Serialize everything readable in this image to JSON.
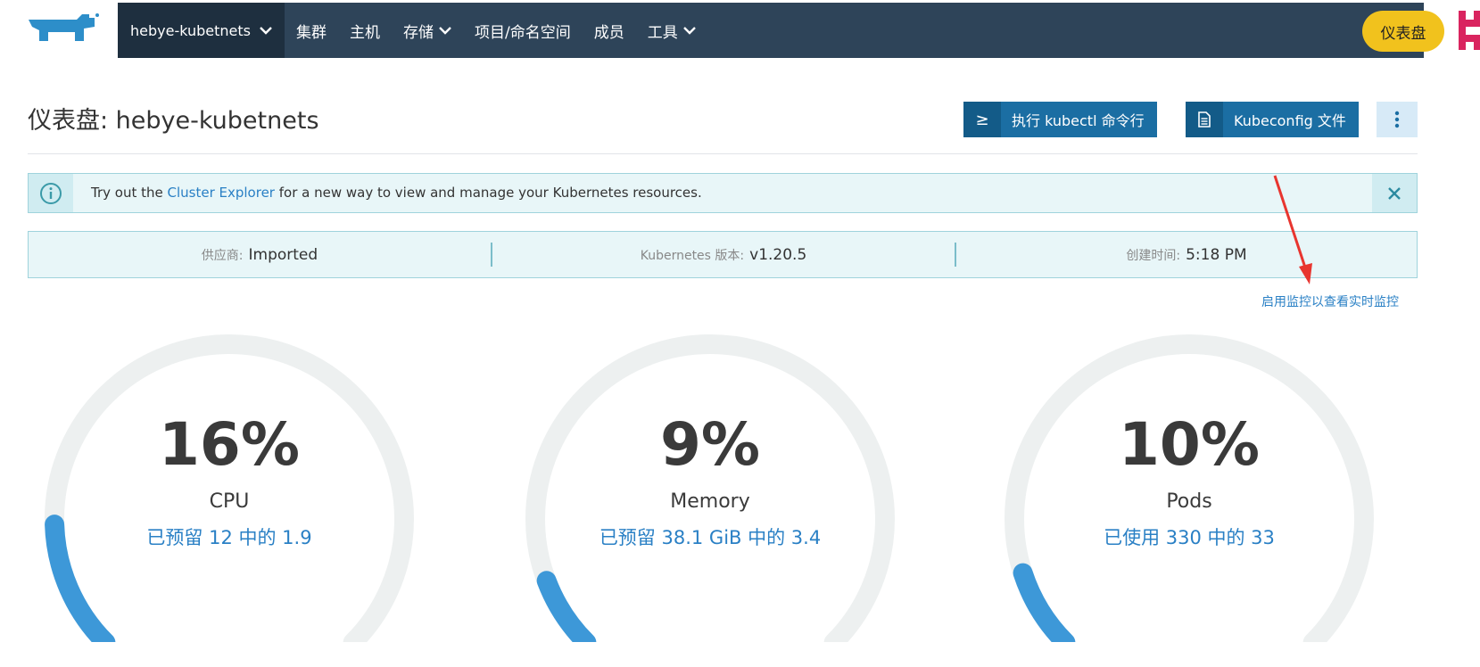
{
  "nav": {
    "cluster_name": "hebye-kubetnets",
    "items": [
      {
        "label": "集群",
        "dropdown": false
      },
      {
        "label": "主机",
        "dropdown": false
      },
      {
        "label": "存储",
        "dropdown": true
      },
      {
        "label": "项目/命名空间",
        "dropdown": false
      },
      {
        "label": "成员",
        "dropdown": false
      },
      {
        "label": "工具",
        "dropdown": true
      }
    ],
    "dashboard_button": "仪表盘"
  },
  "header": {
    "title": "仪表盘: hebye-kubetnets",
    "kubectl_icon": "≥",
    "kubectl_button": "执行 kubectl 命令行",
    "kubeconfig_button": "Kubeconfig 文件"
  },
  "banner": {
    "prefix": "Try out the ",
    "link": "Cluster Explorer",
    "suffix": " for a new way to view and manage your Kubernetes resources."
  },
  "info": {
    "provider_label": "供应商:",
    "provider_value": "Imported",
    "version_label": "Kubernetes 版本:",
    "version_value": "v1.20.5",
    "created_label": "创建时间:",
    "created_value": "5:18 PM"
  },
  "monitoring_link": "启用监控以查看实时监控",
  "gauges": [
    {
      "percent_text": "16%",
      "percent": 16,
      "label": "CPU",
      "detail": "已预留  12  中的  1.9"
    },
    {
      "percent_text": "9%",
      "percent": 9,
      "label": "Memory",
      "detail": "已预留  38.1 GiB  中的  3.4"
    },
    {
      "percent_text": "10%",
      "percent": 10,
      "label": "Pods",
      "detail": "已使用  330  中的  33"
    }
  ],
  "colors": {
    "nav_bg": "#2e4459",
    "cluster_bg": "#1e2f3f",
    "accent": "#1b6ea3",
    "link": "#2a80c5",
    "dashboard_yellow": "#f1c21d",
    "gauge_track": "#edf0f0",
    "gauge_fill": "#3d98d8",
    "annotation_arrow": "#e8352f"
  }
}
